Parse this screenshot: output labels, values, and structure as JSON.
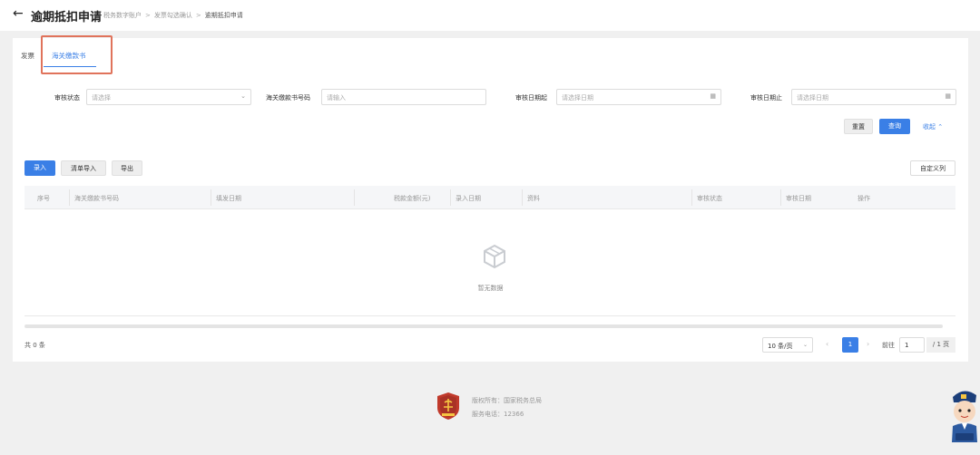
{
  "header": {
    "title": "逾期抵扣申请",
    "breadcrumb": [
      "税务数字账户",
      "发票勾选确认",
      "逾期抵扣申请"
    ]
  },
  "tabs": [
    {
      "label": "发票",
      "active": false
    },
    {
      "label": "海关缴款书",
      "active": true
    }
  ],
  "filters": {
    "status": {
      "label": "审核状态",
      "placeholder": "请选择"
    },
    "number": {
      "label": "海关缴款书号码",
      "placeholder": "请输入"
    },
    "date_start": {
      "label": "审核日期起",
      "placeholder": "请选择日期"
    },
    "date_end": {
      "label": "审核日期止",
      "placeholder": "请选择日期"
    }
  },
  "search_actions": {
    "reset": "重置",
    "query": "查询",
    "collapse": "收起"
  },
  "toolbar": {
    "enter": "录入",
    "import": "清单导入",
    "export": "导出",
    "customize": "自定义列"
  },
  "table": {
    "columns": [
      "序号",
      "海关缴款书号码",
      "填发日期",
      "税款金额(元)",
      "录入日期",
      "资料",
      "审核状态",
      "审核日期",
      "操作"
    ],
    "rows": [],
    "empty_text": "暂无数据"
  },
  "pagination": {
    "total": "共 0 条",
    "page_size": "10 条/页",
    "current_page": "1",
    "goto_label": "前往",
    "goto_value": "1",
    "total_pages": "/ 1 页"
  },
  "footer": {
    "copyright": "版权所有：国家税务总局",
    "phone": "服务电话：12366"
  },
  "colors": {
    "accent": "#3a7fe6",
    "highlight_box": "#e0735b",
    "logo_red": "#c0392b"
  }
}
